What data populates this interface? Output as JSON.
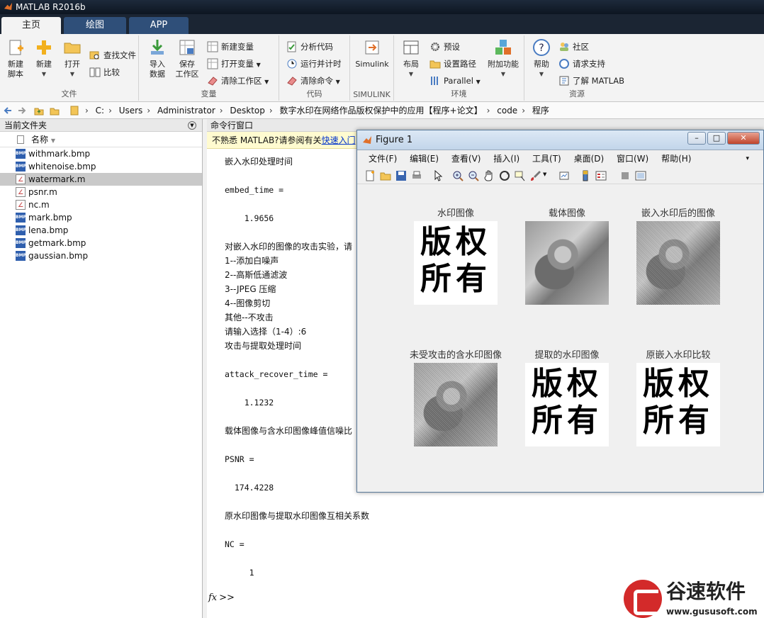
{
  "app": {
    "title": "MATLAB R2016b"
  },
  "tabs": [
    {
      "label": "主页"
    },
    {
      "label": "绘图"
    },
    {
      "label": "APP"
    }
  ],
  "ribbon": {
    "file": {
      "group": "文件",
      "new_script": "新建\n脚本",
      "new": "新建",
      "open": "打开",
      "find_files": "查找文件",
      "compare": "比较"
    },
    "variable": {
      "group": "变量",
      "import": "导入\n数据",
      "save_ws": "保存\n工作区",
      "new_var": "新建变量",
      "open_var": "打开变量",
      "clear_ws": "清除工作区"
    },
    "code": {
      "group": "代码",
      "analyze": "分析代码",
      "run_time": "运行并计时",
      "clear_cmd": "清除命令"
    },
    "simulink": {
      "group": "SIMULINK",
      "simulink": "Simulink"
    },
    "env": {
      "group": "环境",
      "layout": "布局",
      "prefs": "预设",
      "set_path": "设置路径",
      "parallel": "Parallel",
      "addons": "附加功能"
    },
    "resources": {
      "group": "资源",
      "help": "帮助",
      "community": "社区",
      "support": "请求支持",
      "learn": "了解 MATLAB"
    }
  },
  "address": {
    "crumbs": [
      "C:",
      "Users",
      "Administrator",
      "Desktop",
      "数字水印在网络作品版权保护中的应用【程序+论文】",
      "code",
      "程序"
    ]
  },
  "file_panel": {
    "title": "当前文件夹",
    "column": "名称",
    "files": [
      {
        "name": "withmark.bmp",
        "type": "bmp"
      },
      {
        "name": "whitenoise.bmp",
        "type": "bmp"
      },
      {
        "name": "watermark.m",
        "type": "m"
      },
      {
        "name": "psnr.m",
        "type": "m"
      },
      {
        "name": "nc.m",
        "type": "m"
      },
      {
        "name": "mark.bmp",
        "type": "bmp"
      },
      {
        "name": "lena.bmp",
        "type": "bmp"
      },
      {
        "name": "getmark.bmp",
        "type": "bmp"
      },
      {
        "name": "gaussian.bmp",
        "type": "bmp"
      }
    ],
    "selected_index": 2
  },
  "command_window": {
    "title": "命令行窗口",
    "info_prefix": "不熟悉 MATLAB?请参阅有关",
    "info_link": "快速入门",
    "lines": [
      {
        "text": "嵌入水印处理时间",
        "mono": false
      },
      {
        "text": "",
        "mono": false
      },
      {
        "text": "embed_time =",
        "mono": true
      },
      {
        "text": "",
        "mono": false
      },
      {
        "text": "    1.9656",
        "mono": true
      },
      {
        "text": "",
        "mono": false
      },
      {
        "text": "对嵌入水印的图像的攻击实验，请",
        "mono": false
      },
      {
        "text": "1--添加白噪声",
        "mono": false
      },
      {
        "text": "2--高斯低通滤波",
        "mono": false
      },
      {
        "text": "3--JPEG 压缩",
        "mono": false
      },
      {
        "text": "4--图像剪切",
        "mono": false
      },
      {
        "text": "其他--不攻击",
        "mono": false
      },
      {
        "text": "请输入选择（1-4）:6",
        "mono": false
      },
      {
        "text": "攻击与提取处理时间",
        "mono": false
      },
      {
        "text": "",
        "mono": false
      },
      {
        "text": "attack_recover_time =",
        "mono": true
      },
      {
        "text": "",
        "mono": false
      },
      {
        "text": "    1.1232",
        "mono": true
      },
      {
        "text": "",
        "mono": false
      },
      {
        "text": "载体图像与含水印图像峰值信噪比",
        "mono": false
      },
      {
        "text": "",
        "mono": false
      },
      {
        "text": "PSNR =",
        "mono": true
      },
      {
        "text": "",
        "mono": false
      },
      {
        "text": "  174.4228",
        "mono": true
      },
      {
        "text": "",
        "mono": false
      },
      {
        "text": "原水印图像与提取水印图像互相关系数",
        "mono": false
      },
      {
        "text": "",
        "mono": false
      },
      {
        "text": "NC =",
        "mono": true
      },
      {
        "text": "",
        "mono": false
      },
      {
        "text": "     1",
        "mono": true
      }
    ],
    "prompt_fx": "fx",
    "prompt": ">>"
  },
  "figure": {
    "title": "Figure 1",
    "menu": [
      "文件(F)",
      "编辑(E)",
      "查看(V)",
      "插入(I)",
      "工具(T)",
      "桌面(D)",
      "窗口(W)",
      "帮助(H)"
    ],
    "subplots": [
      {
        "title": "水印图像",
        "kind": "watermark",
        "text": "版权\n所有"
      },
      {
        "title": "载体图像",
        "kind": "photo"
      },
      {
        "title": "嵌入水印后的图像",
        "kind": "noisy"
      },
      {
        "title": "未受攻击的含水印图像",
        "kind": "noisy"
      },
      {
        "title": "提取的水印图像",
        "kind": "watermark",
        "text": "版权\n所有"
      },
      {
        "title": "原嵌入水印比较",
        "kind": "watermark",
        "text": "版权\n所有"
      }
    ]
  },
  "brand": {
    "name": "谷速软件",
    "url": "www.gususoft.com"
  }
}
